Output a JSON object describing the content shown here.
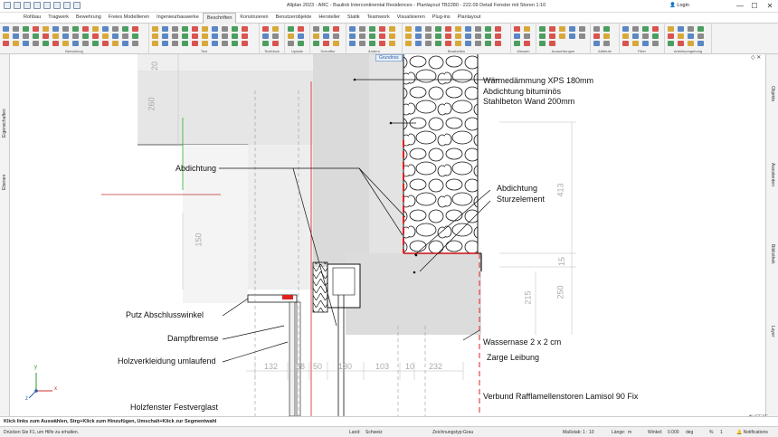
{
  "window": {
    "title": "Allplan 2023 - ARC - Baulink Intercontinental Residences - Planlayout TB2280 - 222.09 Detail Fenster mit Storen 1:10",
    "login_label": "Login",
    "minimize": "—",
    "maximize": "☐",
    "close": "✕"
  },
  "ribbon": {
    "tabs": [
      "Rohbau",
      "Tragwerk",
      "Bewehrung",
      "Freies Modellieren",
      "Ingenieurbauwerke",
      "Beschriften",
      "Konstruieren",
      "Benutzerobjekte",
      "Hersteller",
      "Statik",
      "Teamwork",
      "Visualisieren",
      "Plug-ins",
      "Planlayout"
    ],
    "active_tab": "Beschriften",
    "groups": [
      "Bemaßung",
      "Text",
      "Textblock",
      "Update",
      "Schraffur",
      "Ändern",
      "Bearbeiten",
      "Messen",
      "Auswertungen",
      "Attribute",
      "Filter",
      "Arbeitsumgebung"
    ]
  },
  "left_panel": {
    "tabs": [
      "Eigenschaften",
      "Ebenen"
    ]
  },
  "right_panel": {
    "tabs": [
      "Objekte",
      "Assistenten",
      "Bibliothek",
      "Layer"
    ]
  },
  "viewport": {
    "view_label": "Grundriss",
    "view_controls": "◇ ✕",
    "logo": "◧ ICEYE"
  },
  "drawing": {
    "annotations": {
      "daemmung": "Wärmedämmung XPS 180mm",
      "abdichtung_bit": "Abdichtung bituminös",
      "stahlbeton": "Stahlbeton Wand 200mm",
      "abdichtung_left": "Abdichtung",
      "abdichtung_right": "Abdichtung",
      "sturz": "Sturzelement",
      "putz": "Putz Abschlusswinkel",
      "dampf": "Dampfbremse",
      "holzverkleidung": "Holzverkleidung umlaufend",
      "holzfenster": "Holzfenster Festverglast",
      "wassernase": "Wassernase 2 x 2 cm",
      "zarge": "Zarge Leibung",
      "verbund": "Verbund Rafflamellenstoren Lamisol 90 Fix"
    },
    "dimensions": {
      "d20": "20",
      "d260": "260",
      "d150": "150",
      "d413": "413",
      "d15": "15",
      "d215": "215",
      "d250": "250",
      "bottom": [
        "132",
        "68",
        "50",
        "130",
        "103",
        "10",
        "232"
      ]
    },
    "axes": {
      "y": "y",
      "x": "x",
      "z": "z"
    }
  },
  "prompt": "Klick links zum Auswählen, Strg+Klick zum Hinzufügen, Umschalt+Klick zur Segmentwahl",
  "status": {
    "hint": "Drücken Sie F1, um Hilfe zu erhalten.",
    "land_label": "Land:",
    "land_value": "Schweiz",
    "zeichnungstyp_label": "Zeichnungstyp:",
    "zeichnungstyp_value": "Grau",
    "massstab_label": "Maßstab:",
    "massstab_value": "1 : 10",
    "laenge_label": "Länge:",
    "laenge_value": "m",
    "winkel_label": "Winkel:",
    "winkel_value": "0.000",
    "winkel_unit": "deg",
    "percent_sign": "%",
    "percent_value": "1",
    "notifications": "Notifications"
  },
  "colors": {
    "accent_blue": "#2a5da8",
    "red_line": "#e02020",
    "ribbon_bg": "#f3f3f3"
  }
}
